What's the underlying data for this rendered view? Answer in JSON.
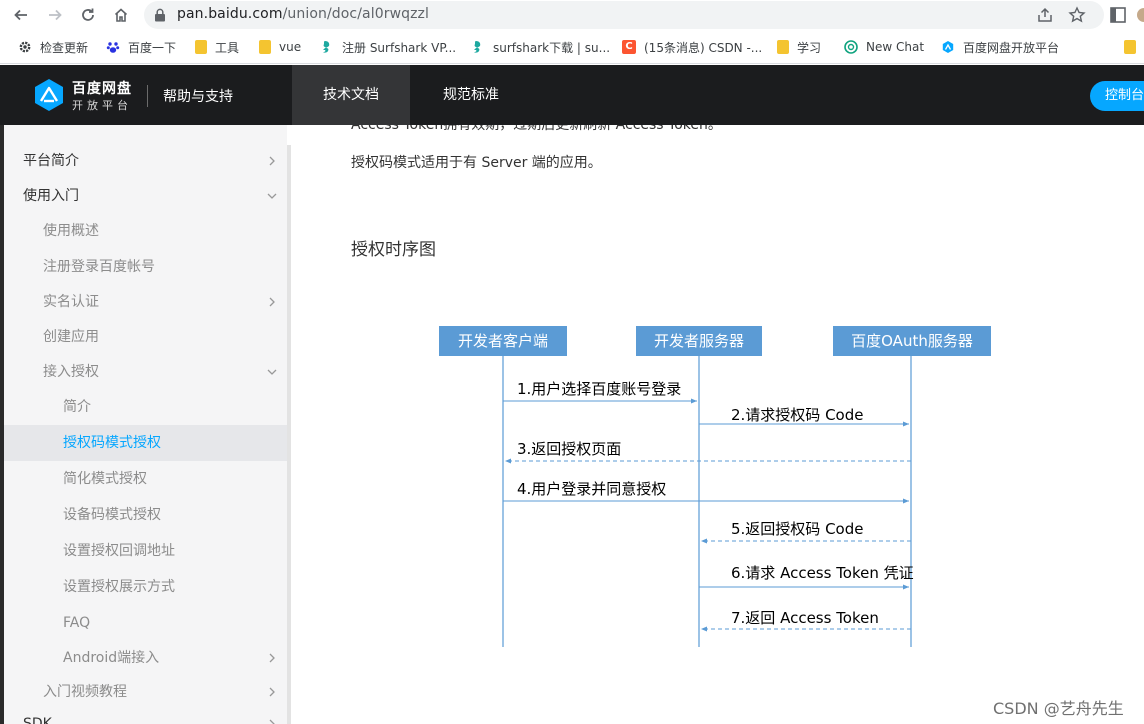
{
  "browser": {
    "url_host": "pan.baidu.com",
    "url_path": "/union/doc/al0rwqzzl",
    "bookmarks": [
      {
        "label": "检查更新",
        "icon": "gear-icon"
      },
      {
        "label": "百度一下",
        "icon": "baidu-paw-icon"
      },
      {
        "label": "工具",
        "icon": "folder-icon"
      },
      {
        "label": "vue",
        "icon": "folder-icon"
      },
      {
        "label": "注册 Surfshark VP...",
        "icon": "surfshark-icon"
      },
      {
        "label": "surfshark下载 | su...",
        "icon": "surfshark-icon"
      },
      {
        "label": "(15条消息) CSDN -...",
        "icon": "csdn-icon"
      },
      {
        "label": "学习",
        "icon": "folder-icon"
      },
      {
        "label": "New Chat",
        "icon": "chatgpt-icon"
      },
      {
        "label": "百度网盘开放平台",
        "icon": "baidu-pan-icon"
      }
    ]
  },
  "header": {
    "logo_title": "百度网盘",
    "logo_subtitle": "开放平台",
    "help": "帮助与支持",
    "tabs": [
      {
        "label": "技术文档",
        "active": true
      },
      {
        "label": "规范标准",
        "active": false
      }
    ],
    "console": "控制台"
  },
  "sidebar": {
    "items": [
      {
        "label": "平台简介",
        "level": 1,
        "chevron": "right"
      },
      {
        "label": "使用入门",
        "level": 1,
        "chevron": "down"
      },
      {
        "label": "使用概述",
        "level": 2,
        "chevron": ""
      },
      {
        "label": "注册登录百度帐号",
        "level": 2,
        "chevron": ""
      },
      {
        "label": "实名认证",
        "level": 2,
        "chevron": "right"
      },
      {
        "label": "创建应用",
        "level": 2,
        "chevron": ""
      },
      {
        "label": "接入授权",
        "level": 2,
        "chevron": "down"
      },
      {
        "label": "简介",
        "level": 3,
        "chevron": ""
      },
      {
        "label": "授权码模式授权",
        "level": 3,
        "chevron": "",
        "active": true
      },
      {
        "label": "简化模式授权",
        "level": 3,
        "chevron": ""
      },
      {
        "label": "设备码模式授权",
        "level": 3,
        "chevron": ""
      },
      {
        "label": "设置授权回调地址",
        "level": 3,
        "chevron": ""
      },
      {
        "label": "设置授权展示方式",
        "level": 3,
        "chevron": ""
      },
      {
        "label": "FAQ",
        "level": 3,
        "chevron": ""
      },
      {
        "label": "Android端接入",
        "level": 3,
        "chevron": "right"
      },
      {
        "label": "入门视频教程",
        "level": 2,
        "chevron": "right"
      },
      {
        "label": "SDK",
        "level": 1,
        "chevron": "right"
      }
    ]
  },
  "content": {
    "clipped_line": "Access Token拥有效期，过期后更新刷新 Access Token。",
    "paragraph": "授权码模式适用于有 Server 端的应用。",
    "heading": "授权时序图",
    "diagram": {
      "actors": [
        "开发者客户端",
        "开发者服务器",
        "百度OAuth服务器"
      ],
      "messages": [
        {
          "label": "1.用户选择百度账号登录",
          "from": 0,
          "to": 1,
          "dashed": false
        },
        {
          "label": "2.请求授权码 Code",
          "from": 1,
          "to": 2,
          "dashed": false
        },
        {
          "label": "3.返回授权页面",
          "from": 2,
          "to": 0,
          "dashed": true
        },
        {
          "label": "4.用户登录并同意授权",
          "from": 0,
          "to": 2,
          "dashed": false
        },
        {
          "label": "5.返回授权码 Code",
          "from": 2,
          "to": 1,
          "dashed": true
        },
        {
          "label": "6.请求 Access Token 凭证",
          "from": 1,
          "to": 2,
          "dashed": false
        },
        {
          "label": "7.返回 Access Token",
          "from": 2,
          "to": 1,
          "dashed": true
        }
      ]
    }
  },
  "watermark": "CSDN @艺舟先生",
  "colors": {
    "accent": "#06a7ff",
    "actor": "#5b9bd5",
    "arrow": "#5b9bd5",
    "header_bg": "#1b1c1e"
  }
}
